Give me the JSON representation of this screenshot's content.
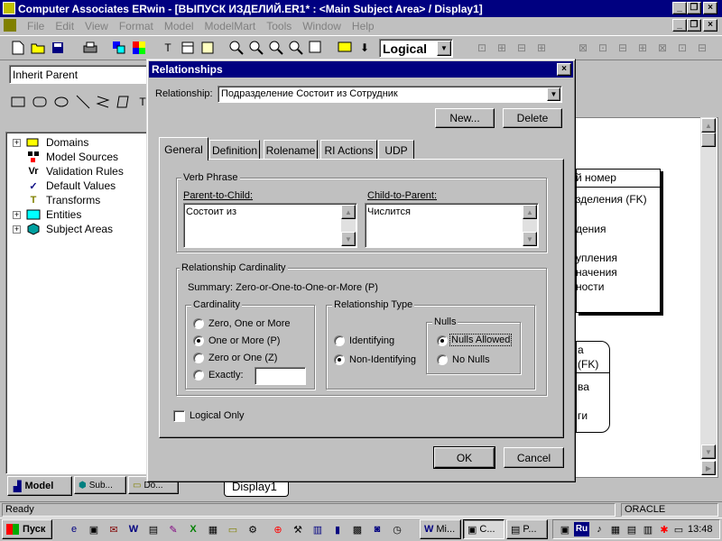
{
  "app": {
    "title": "Computer Associates ERwin - [ВЫПУСК ИЗДЕЛИЙ.ER1* : <Main Subject Area> / Display1]",
    "menus": [
      "File",
      "Edit",
      "View",
      "Format",
      "Model",
      "ModelMart",
      "Tools",
      "Window",
      "Help"
    ],
    "view_mode": "Logical",
    "inherit_combo": "Inherit Parent"
  },
  "tree": {
    "items": [
      {
        "label": "Domains",
        "icon": "domains-icon",
        "expandable": true
      },
      {
        "label": "Model Sources",
        "icon": "model-sources-icon",
        "expandable": false
      },
      {
        "label": "Validation Rules",
        "icon": "validation-rules-icon",
        "expandable": false
      },
      {
        "label": "Default Values",
        "icon": "default-values-icon",
        "expandable": false
      },
      {
        "label": "Transforms",
        "icon": "transforms-icon",
        "expandable": false
      },
      {
        "label": "Entities",
        "icon": "entities-icon",
        "expandable": true
      },
      {
        "label": "Subject Areas",
        "icon": "subject-areas-icon",
        "expandable": true
      }
    ],
    "bottom_tabs": [
      "Model",
      "Sub...",
      "Do..."
    ]
  },
  "diagram": {
    "entity1": [
      "й номер",
      "зделения (FK)",
      "дения",
      "упления",
      "начения",
      "ности"
    ],
    "entity2": [
      "а",
      "(FK)",
      "ва",
      "ги"
    ],
    "display_tab": "Display1"
  },
  "dialog": {
    "title": "Relationships",
    "relationship_label": "Relationship:",
    "relationship_value": "Подразделение Состоит из Сотрудник",
    "new_button": "New...",
    "delete_button": "Delete",
    "tabs": [
      "General",
      "Definition",
      "Rolename",
      "RI Actions",
      "UDP"
    ],
    "verb_phrase": {
      "title": "Verb Phrase",
      "parent_label": "Parent-to-Child:",
      "parent_value": "Состоит из",
      "child_label": "Child-to-Parent:",
      "child_value": "Числится"
    },
    "cardinality": {
      "title": "Relationship Cardinality",
      "summary": "Summary:  Zero-or-One-to-One-or-More (P)",
      "group_title": "Cardinality",
      "options": [
        "Zero, One or More",
        "One or More (P)",
        "Zero or One (Z)",
        "Exactly:"
      ],
      "selected": 1
    },
    "relationship_type": {
      "title": "Relationship Type",
      "options": [
        "Identifying",
        "Non-Identifying"
      ],
      "selected": 1,
      "nulls_title": "Nulls",
      "nulls_options": [
        "Nulls Allowed",
        "No Nulls"
      ],
      "nulls_selected": 0
    },
    "logical_only": "Logical Only",
    "ok_button": "OK",
    "cancel_button": "Cancel"
  },
  "status": {
    "text": "Ready",
    "db": "ORACLE"
  },
  "taskbar": {
    "start": "Пуск",
    "tasks": [
      "Mi...",
      "C...",
      "P..."
    ],
    "lang": "Ru",
    "clock": "13:48"
  }
}
